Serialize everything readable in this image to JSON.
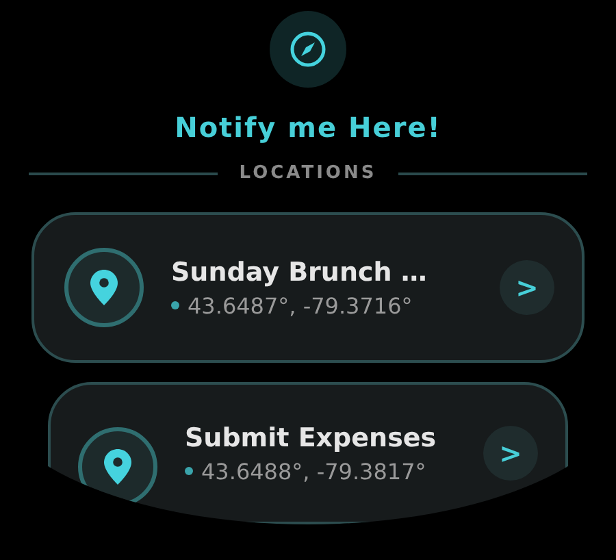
{
  "title": "Notify me Here!",
  "section": "LOCATIONS",
  "locations": [
    {
      "name": "Sunday Brunch …",
      "coords": "43.6487°, -79.3716°",
      "button": ">"
    },
    {
      "name": "Submit Expenses",
      "coords": "43.6488°, -79.3817°",
      "button": ">"
    }
  ]
}
